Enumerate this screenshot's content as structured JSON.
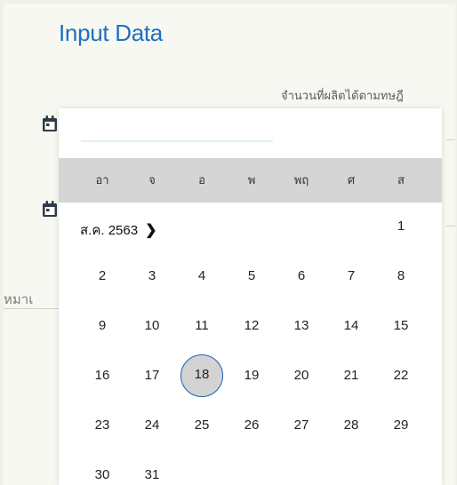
{
  "header": {
    "title": "Input Data"
  },
  "form": {
    "quantity_label": "จำนวนที่ผลิตได้ตามทษฎี",
    "note_label_partial": "หมาเ"
  },
  "datepicker": {
    "weekdays": [
      "อา",
      "จ",
      "อ",
      "พ",
      "พฤ",
      "ศ",
      "ส"
    ],
    "month_label": "ส.ค. 2563",
    "next_icon": "chevron-right-icon",
    "selected_day": "18",
    "weeks": [
      [
        "",
        "",
        "",
        "",
        "",
        "",
        "1"
      ],
      [
        "2",
        "3",
        "4",
        "5",
        "6",
        "7",
        "8"
      ],
      [
        "9",
        "10",
        "11",
        "12",
        "13",
        "14",
        "15"
      ],
      [
        "16",
        "17",
        "18",
        "19",
        "20",
        "21",
        "22"
      ],
      [
        "23",
        "24",
        "25",
        "26",
        "27",
        "28",
        "29"
      ],
      [
        "30",
        "31",
        "",
        "",
        "",
        "",
        ""
      ]
    ]
  },
  "colors": {
    "title": "#1f6fc0",
    "weekday_bar": "#d5d5d5",
    "selected_ring": "#1a5fb4"
  },
  "icons": {
    "field_icon": "calendar-icon"
  }
}
